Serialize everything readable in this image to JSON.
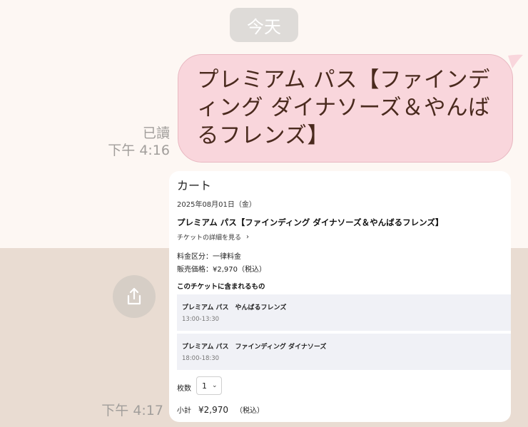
{
  "chat": {
    "date_divider": "今天",
    "read_status": "已讀",
    "message_time_1": "下午 4:16",
    "message_time_2": "下午 4:17",
    "message_text": "プレミアム パス【ファインディング ダイナソーズ＆やんばるフレンズ】",
    "bubble_color": "#f9d6dc",
    "share_icon": "share-icon"
  },
  "cart": {
    "title": "カート",
    "date": "2025年08月01日（金）",
    "ticket_name": "プレミアム パス【ファインディング ダイナソーズ＆やんばるフレンズ】",
    "details_link": "チケットの詳細を見る",
    "price_category": "料金区分：一律料金",
    "sale_price": "販売価格：¥2,970（税込）",
    "included_heading": "このチケットに含まれるもの",
    "items": [
      {
        "name": "プレミアム パス　やんばるフレンズ",
        "time": "13:00-13:30"
      },
      {
        "name": "プレミアム パス　ファインディング ダイナソーズ",
        "time": "18:00-18:30"
      }
    ],
    "quantity_label": "枚数",
    "quantity_value": "1",
    "subtotal_label": "小計",
    "subtotal_amount": "¥2,970",
    "subtotal_tax": "（税込）"
  }
}
